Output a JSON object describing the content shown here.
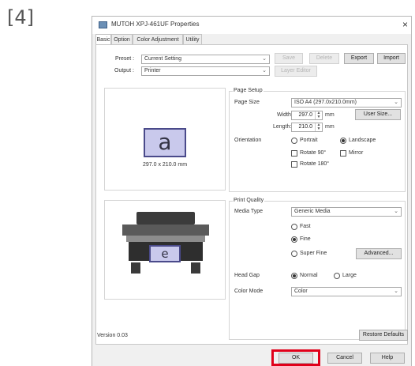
{
  "step_label": "[4]",
  "window": {
    "title": "MUTOH XPJ-461UF Properties",
    "close": "×"
  },
  "tabs": [
    {
      "label": "Basic",
      "active": true
    },
    {
      "label": "Option",
      "active": false
    },
    {
      "label": "Color Adjustment",
      "active": false
    },
    {
      "label": "Utility",
      "active": false
    }
  ],
  "preset": {
    "label": "Preset :",
    "value": "Current Setting"
  },
  "output": {
    "label": "Output :",
    "value": "Printer"
  },
  "top_buttons": {
    "save": "Save",
    "delete": "Delete",
    "export": "Export",
    "import": "Import",
    "layer_editor": "Layer Editor"
  },
  "preview": {
    "letter": "a",
    "size_text": "297.0 x 210.0 mm",
    "printer_letter": "e"
  },
  "page_setup": {
    "title": "Page Setup",
    "page_size_label": "Page Size",
    "page_size_value": "ISO A4 (297.0x210.0mm)",
    "width_label": "Width:",
    "width_value": "297.0",
    "length_label": "Length:",
    "length_value": "210.0",
    "unit": "mm",
    "user_size_button": "User Size...",
    "orientation_label": "Orientation",
    "portrait": "Portrait",
    "landscape": "Landscape",
    "rotate90": "Rotate 90°",
    "mirror": "Mirror",
    "rotate180": "Rotate 180°"
  },
  "print_quality": {
    "title": "Print Quality",
    "media_type_label": "Media Type",
    "media_type_value": "Generic Media",
    "fast": "Fast",
    "fine": "Fine",
    "super_fine": "Super Fine",
    "advanced_button": "Advanced...",
    "head_gap_label": "Head Gap",
    "normal": "Normal",
    "large": "Large",
    "color_mode_label": "Color Mode",
    "color_mode_value": "Color"
  },
  "version": "Version 0.03",
  "restore_defaults": "Restore Defaults",
  "footer": {
    "ok": "OK",
    "cancel": "Cancel",
    "help": "Help"
  },
  "colors": {
    "highlight": "#e0001a",
    "preview_fill": "#c9c9ec",
    "preview_border": "#4a4a8a"
  }
}
